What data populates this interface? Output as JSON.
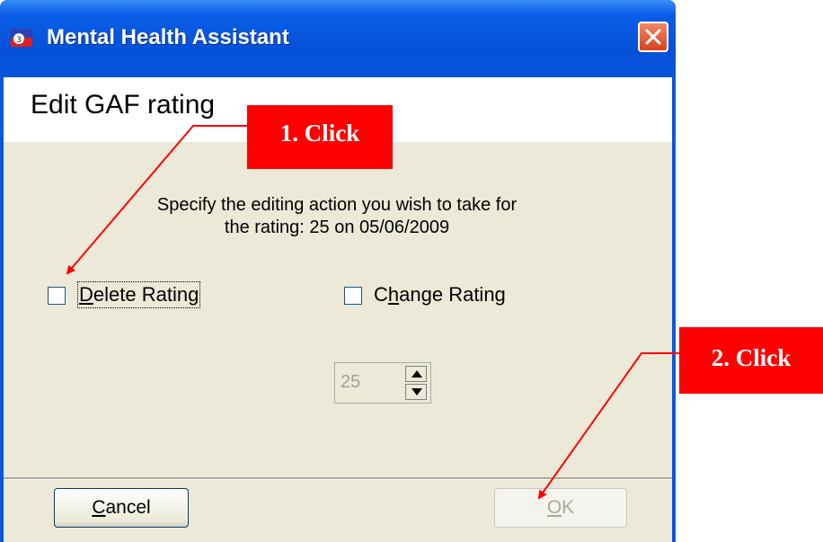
{
  "window": {
    "title": "Mental Health Assistant",
    "icon": "app-icon",
    "close_icon": "close-icon"
  },
  "header": {
    "title": "Edit GAF rating"
  },
  "instruction": {
    "line1": "Specify the editing action you wish to take for",
    "line2": "the rating: 25 on 05/06/2009"
  },
  "options": {
    "delete": {
      "accel": "D",
      "rest": "elete Rating",
      "checked": false
    },
    "change": {
      "pre": "C",
      "accel": "h",
      "rest": "ange Rating",
      "checked": false
    }
  },
  "spinner": {
    "value": "25",
    "enabled": false
  },
  "buttons": {
    "cancel": {
      "accel": "C",
      "rest": "ancel"
    },
    "ok": {
      "accel": "O",
      "rest": "K",
      "enabled": false
    }
  },
  "annotations": {
    "step1": "1. Click",
    "step2": "2. Click",
    "color": "#ff0000"
  },
  "colors": {
    "titlebar": "#0450d8",
    "dialog_bg": "#ece9d8",
    "close_button": "#d7401f"
  }
}
